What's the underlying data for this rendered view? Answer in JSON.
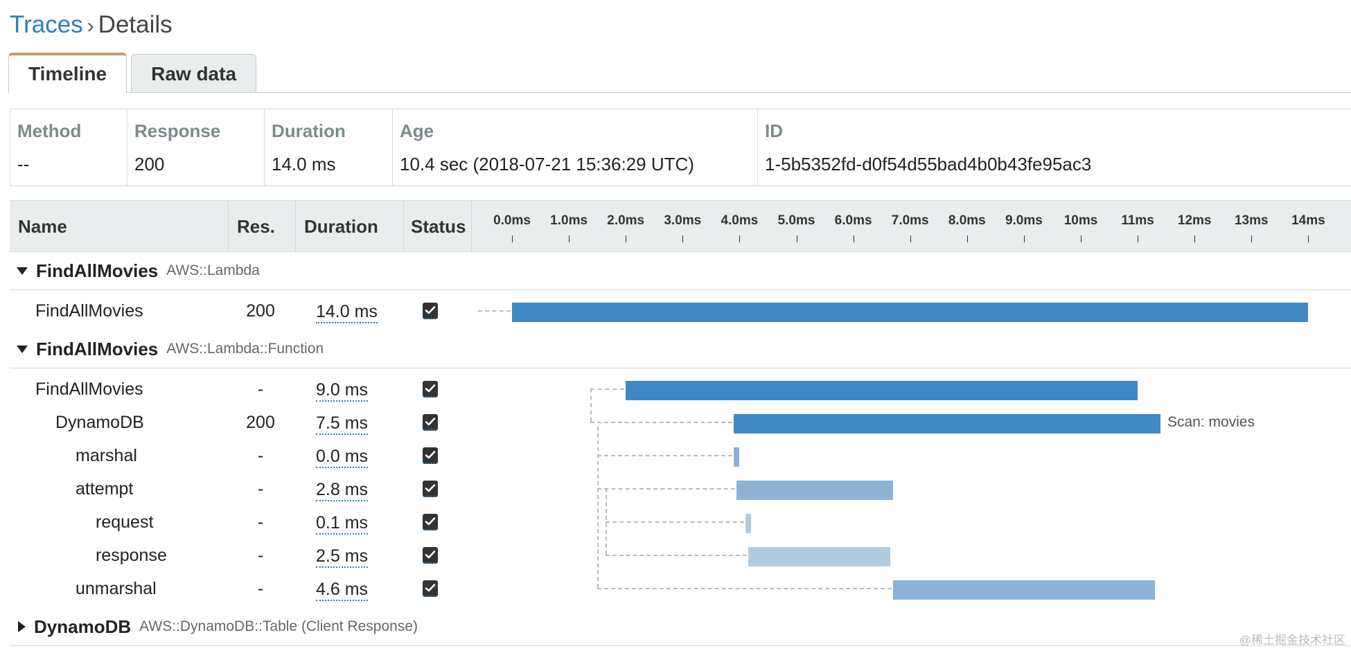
{
  "breadcrumb": {
    "parent": "Traces",
    "separator": "›",
    "current": "Details"
  },
  "tabs": [
    {
      "label": "Timeline",
      "active": true
    },
    {
      "label": "Raw data",
      "active": false
    }
  ],
  "summary": {
    "method_label": "Method",
    "method_value": "--",
    "response_label": "Response",
    "response_value": "200",
    "duration_label": "Duration",
    "duration_value": "14.0 ms",
    "age_label": "Age",
    "age_value": "10.4 sec (2018-07-21 15:36:29 UTC)",
    "id_label": "ID",
    "id_value": "1-5b5352fd-d0f54d55bad4b0b43fe95ac3"
  },
  "timeline": {
    "headers": {
      "name": "Name",
      "res": "Res.",
      "duration": "Duration",
      "status": "Status"
    },
    "axis_ticks": [
      "0.0ms",
      "1.0ms",
      "2.0ms",
      "3.0ms",
      "4.0ms",
      "5.0ms",
      "6.0ms",
      "7.0ms",
      "8.0ms",
      "9.0ms",
      "10ms",
      "11ms",
      "12ms",
      "13ms",
      "14ms"
    ],
    "groups": [
      {
        "name": "FindAllMovies",
        "type": "AWS::Lambda",
        "expanded": true,
        "segments": [
          {
            "name": "FindAllMovies",
            "depth": 0,
            "res": "200",
            "duration": "14.0 ms",
            "status": "ok",
            "start_ms": 0.0,
            "end_ms": 14.0,
            "color": "#3f88c5",
            "label": ""
          }
        ]
      },
      {
        "name": "FindAllMovies",
        "type": "AWS::Lambda::Function",
        "expanded": true,
        "segments": [
          {
            "name": "FindAllMovies",
            "depth": 0,
            "res": "-",
            "duration": "9.0 ms",
            "status": "ok",
            "start_ms": 2.0,
            "end_ms": 11.0,
            "color": "#3f88c5",
            "label": ""
          },
          {
            "name": "DynamoDB",
            "depth": 1,
            "res": "200",
            "duration": "7.5 ms",
            "status": "ok",
            "start_ms": 3.9,
            "end_ms": 11.4,
            "color": "#3f88c5",
            "label": "Scan: movies"
          },
          {
            "name": "marshal",
            "depth": 2,
            "res": "-",
            "duration": "0.0 ms",
            "status": "ok",
            "start_ms": 3.9,
            "end_ms": 4.0,
            "color": "#8cb3d6",
            "label": ""
          },
          {
            "name": "attempt",
            "depth": 2,
            "res": "-",
            "duration": "2.8 ms",
            "status": "ok",
            "start_ms": 3.95,
            "end_ms": 6.7,
            "color": "#8cb3d6",
            "label": ""
          },
          {
            "name": "request",
            "depth": 3,
            "res": "-",
            "duration": "0.1 ms",
            "status": "ok",
            "start_ms": 4.1,
            "end_ms": 4.2,
            "color": "#b3cbe0",
            "label": ""
          },
          {
            "name": "response",
            "depth": 3,
            "res": "-",
            "duration": "2.5 ms",
            "status": "ok",
            "start_ms": 4.15,
            "end_ms": 6.65,
            "color": "#b3cbe0",
            "label": ""
          },
          {
            "name": "unmarshal",
            "depth": 2,
            "res": "-",
            "duration": "4.6 ms",
            "status": "ok",
            "start_ms": 6.7,
            "end_ms": 11.3,
            "color": "#8cb3d6",
            "label": ""
          }
        ]
      },
      {
        "name": "DynamoDB",
        "type": "AWS::DynamoDB::Table (Client Response)",
        "expanded": false,
        "segments": []
      }
    ]
  },
  "watermark": "@稀土掘金技术社区"
}
